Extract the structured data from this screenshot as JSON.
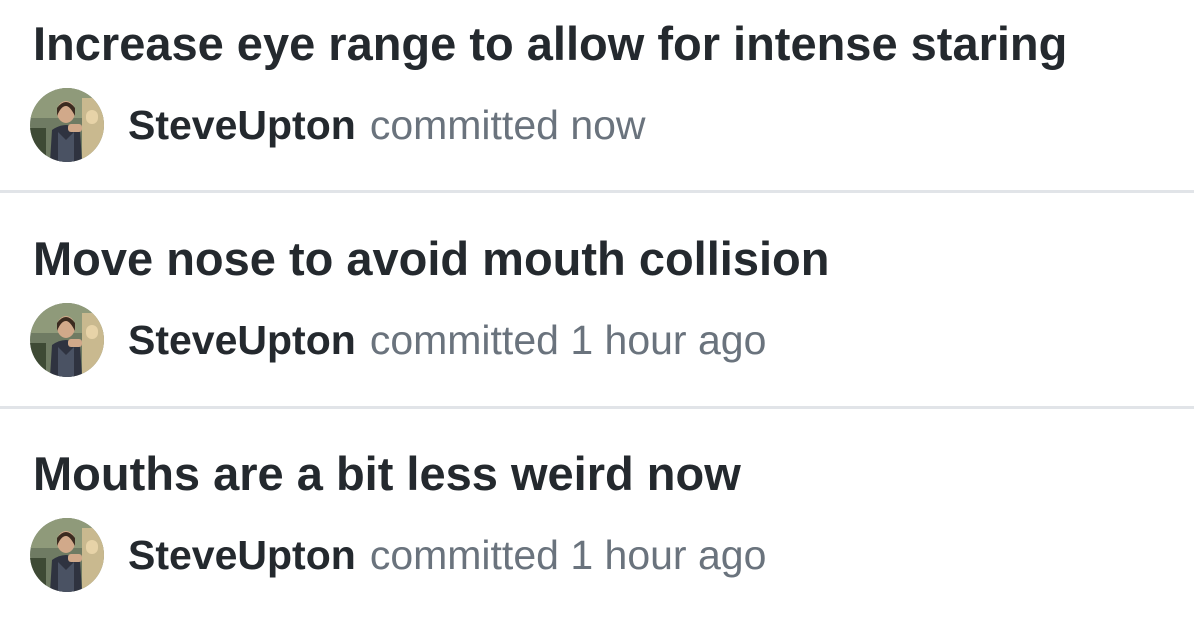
{
  "commits": [
    {
      "title": "Increase eye range to allow for intense staring",
      "author": "SteveUpton",
      "action": "committed",
      "time": "now",
      "avatar_icon": "user-avatar"
    },
    {
      "title": "Move nose to avoid mouth collision",
      "author": "SteveUpton",
      "action": "committed",
      "time": "1 hour ago",
      "avatar_icon": "user-avatar"
    },
    {
      "title": "Mouths are a bit less weird now",
      "author": "SteveUpton",
      "action": "committed",
      "time": "1 hour ago",
      "avatar_icon": "user-avatar"
    }
  ],
  "colors": {
    "title": "#24292e",
    "meta": "#6a737d",
    "divider": "#e1e4e8"
  }
}
